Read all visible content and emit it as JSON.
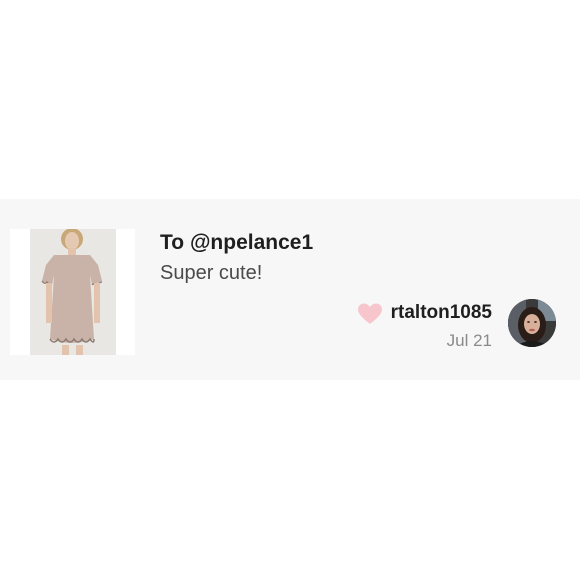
{
  "comment": {
    "to_prefix": "To ",
    "mention": "@npelance1",
    "text": "Super cute!",
    "author": "rtalton1085",
    "date": "Jul 21"
  },
  "icons": {
    "like": "heart-icon"
  },
  "colors": {
    "card_background": "#f7f7f7",
    "heart": "#f7c6cc",
    "primary_text": "#1f1f1f",
    "secondary_text": "#8a8a8a",
    "dress": "#c9b3a8"
  }
}
